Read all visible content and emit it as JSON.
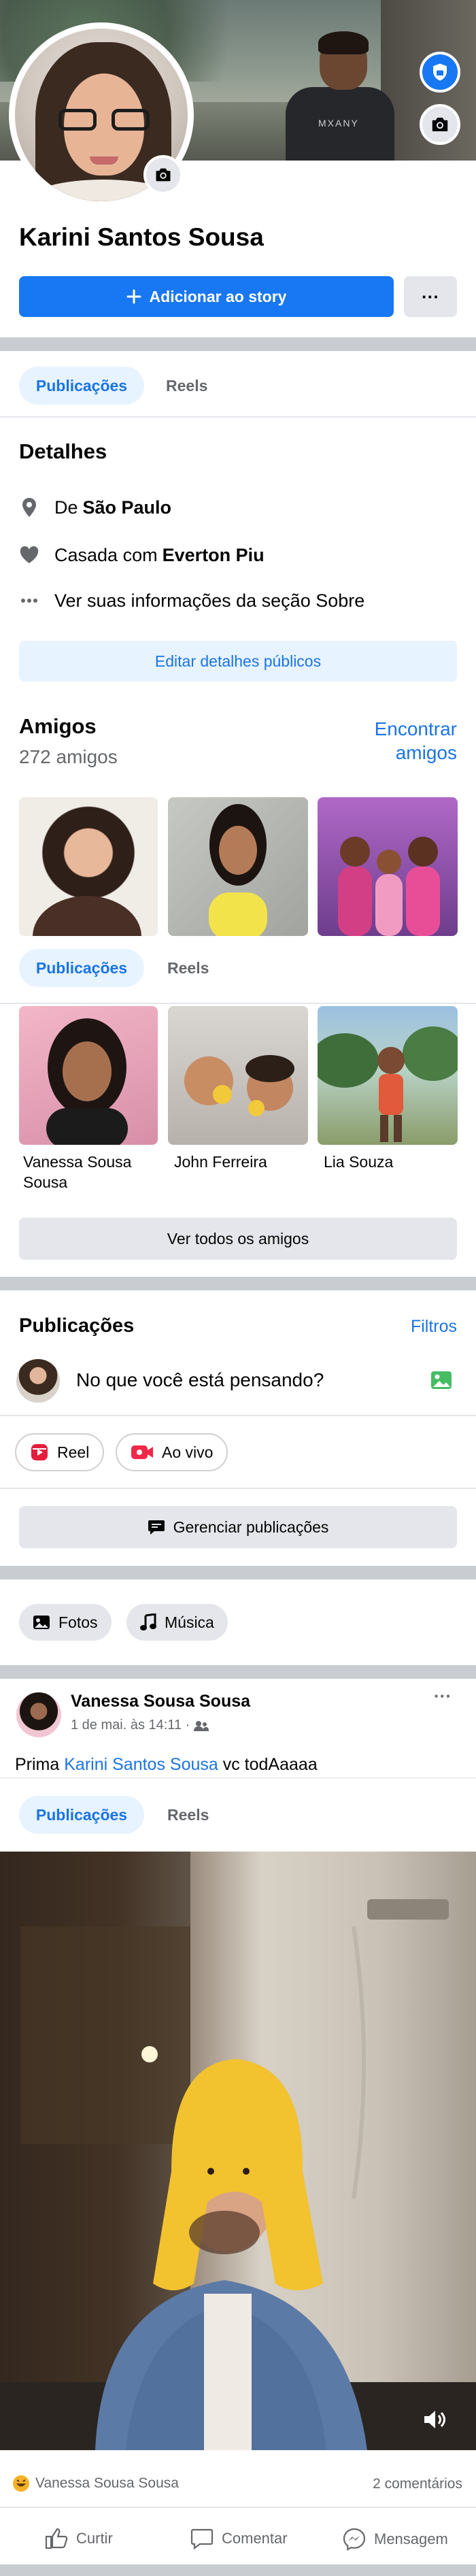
{
  "profile": {
    "name": "Karini Santos Sousa",
    "add_story_label": "Adicionar ao story",
    "more_label": "···",
    "shirt_text": "MXANY"
  },
  "tabs_top": {
    "active": "Publicações",
    "other": "Reels"
  },
  "details": {
    "title": "Detalhes",
    "city_prefix": "De",
    "city": "São Paulo",
    "relationship_prefix": "Casada com",
    "partner": "Everton Piu",
    "see_more": "Ver suas informações da seção Sobre",
    "edit_button": "Editar detalhes públicos"
  },
  "friends": {
    "title": "Amigos",
    "count": "272 amigos",
    "find_link_line1": "Encontrar",
    "find_link_line2": "amigos",
    "tabs": {
      "active": "Publicações",
      "other": "Reels"
    },
    "list": [
      {
        "name_line1": "Vanessa Sousa",
        "name_line2": "Sousa"
      },
      {
        "name_line1": "John Ferreira",
        "name_line2": ""
      },
      {
        "name_line1": "Lia Souza",
        "name_line2": ""
      }
    ],
    "see_all_button": "Ver todos os amigos"
  },
  "posts_section": {
    "title": "Publicações",
    "filters_link": "Filtros",
    "composer_placeholder": "No que você está pensando?",
    "reel_chip": "Reel",
    "live_chip": "Ao vivo",
    "manage_button": "Gerenciar publicações",
    "photos_chip": "Fotos",
    "music_chip": "Música"
  },
  "post": {
    "author": "Vanessa Sousa Sousa",
    "meta": "1 de mai. às 14:11 ·",
    "text_prefix": "Prima",
    "text_mention": "Karini Santos Sousa",
    "text_suffix": "vc todAaaaa",
    "tabs": {
      "active": "Publicações",
      "other": "Reels"
    },
    "reactor": "Vanessa Sousa Sousa",
    "comments": "2 comentários",
    "like_label": "Curtir",
    "comment_label": "Comentar",
    "message_label": "Mensagem"
  },
  "colors": {
    "accent": "#1877f2",
    "link": "#1b74e4",
    "divider": "#c9ccd1",
    "light_blue_bg": "#e7f3ff",
    "gray_button": "#e4e6eb"
  }
}
